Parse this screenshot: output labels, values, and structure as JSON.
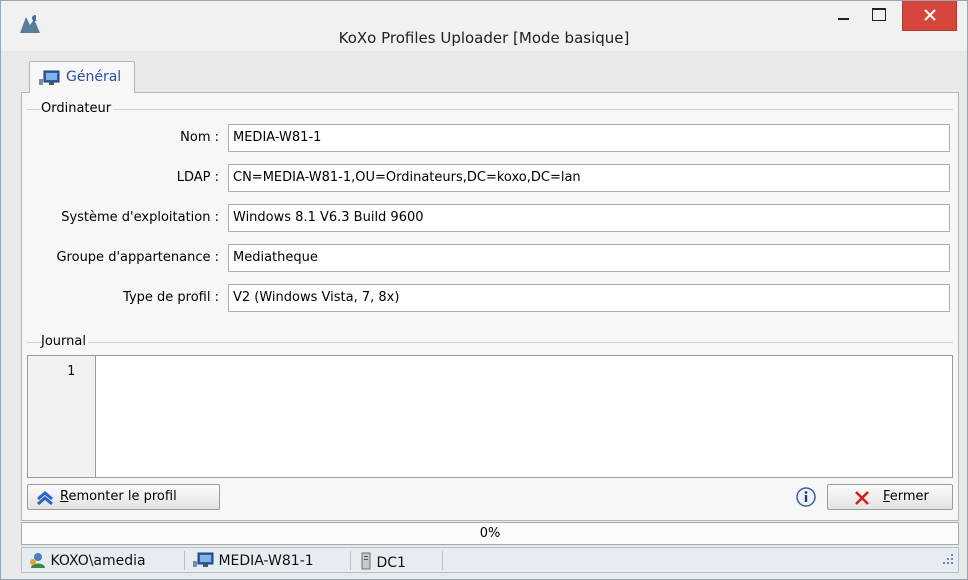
{
  "window": {
    "title": "KoXo Profiles Uploader [Mode basique]"
  },
  "tabs": [
    {
      "label": "Général",
      "icon": "computer-icon",
      "selected": true
    }
  ],
  "computer_group": {
    "title": "Ordinateur",
    "fields": [
      {
        "label": "Nom :",
        "value": "MEDIA-W81-1"
      },
      {
        "label": "LDAP :",
        "value": "CN=MEDIA-W81-1,OU=Ordinateurs,DC=koxo,DC=lan"
      },
      {
        "label": "Système d'exploitation :",
        "value": "Windows 8.1 V6.3 Build 9600"
      },
      {
        "label": "Groupe d'appartenance :",
        "value": "Mediatheque"
      },
      {
        "label": "Type de profil :",
        "value": "V2 (Windows Vista, 7, 8x)"
      }
    ]
  },
  "journal": {
    "title": "Journal",
    "line_numbers": [
      "1"
    ],
    "content": ""
  },
  "buttons": {
    "upload_label_mnemonic": "R",
    "upload_label_rest": "emonter le profil",
    "close_label_mnemonic": "F",
    "close_label_rest": "ermer"
  },
  "progress": {
    "text": "0%",
    "value": 0
  },
  "statusbar": {
    "user": "KOXO\\amedia",
    "computer": "MEDIA-W81-1",
    "server": "DC1"
  },
  "colors": {
    "accent": "#2a4fa8",
    "close_button": "#d6463c"
  }
}
